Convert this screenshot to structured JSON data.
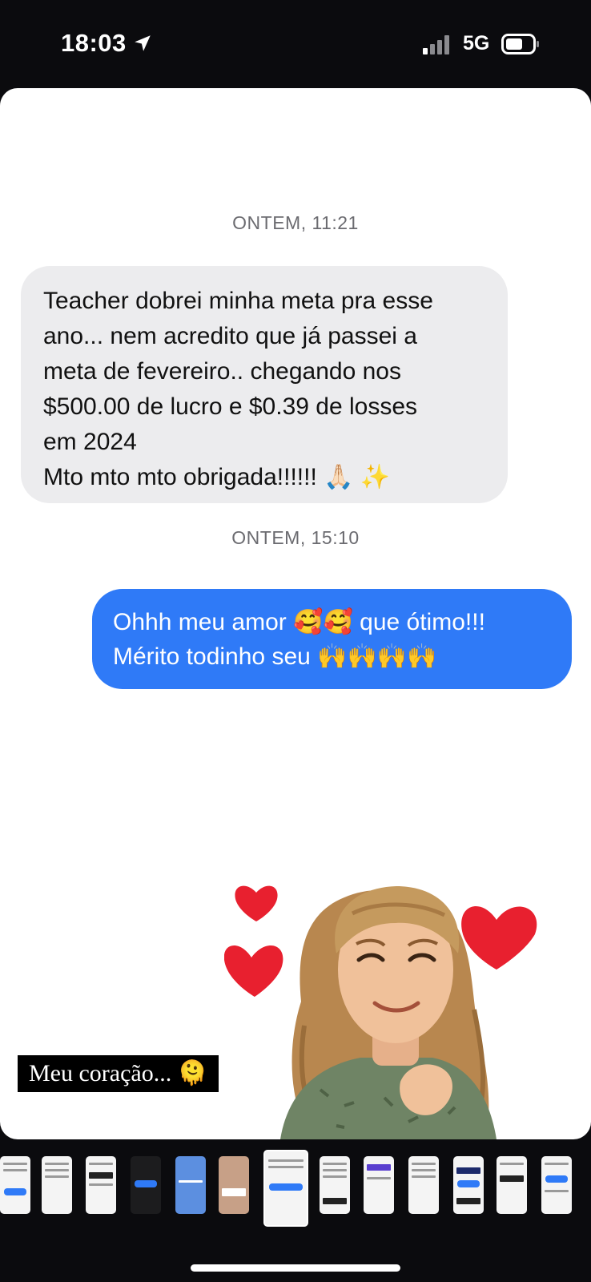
{
  "status_bar": {
    "time": "18:03",
    "network": "5G"
  },
  "conversation": {
    "timestamp_1": "ONTEM, 11:21",
    "incoming_message": {
      "lines": [
        "Teacher dobrei minha meta pra esse",
        "ano... nem acredito que já passei a",
        "meta de fevereiro.. chegando nos",
        "$500.00 de lucro e $0.39 de losses",
        "em 2024",
        "Mto mto mto obrigada!!!!!! 🙏🏻 ✨"
      ]
    },
    "timestamp_2": "ONTEM, 15:10",
    "outgoing_message": {
      "lines": [
        "Ohhh meu amor 🥰🥰 que ótimo!!!",
        "Mérito todinho seu 🙌🙌🙌🙌"
      ]
    }
  },
  "caption": {
    "text": "Meu coração... 🫠"
  },
  "sticker": {
    "name": "avatar-hearts-sticker"
  },
  "colors": {
    "outgoing_bubble": "#2f7af7",
    "incoming_bubble": "#ececee",
    "heart": "#e8202f"
  },
  "story_thumbnails": {
    "count": 13,
    "active_index": 6
  }
}
